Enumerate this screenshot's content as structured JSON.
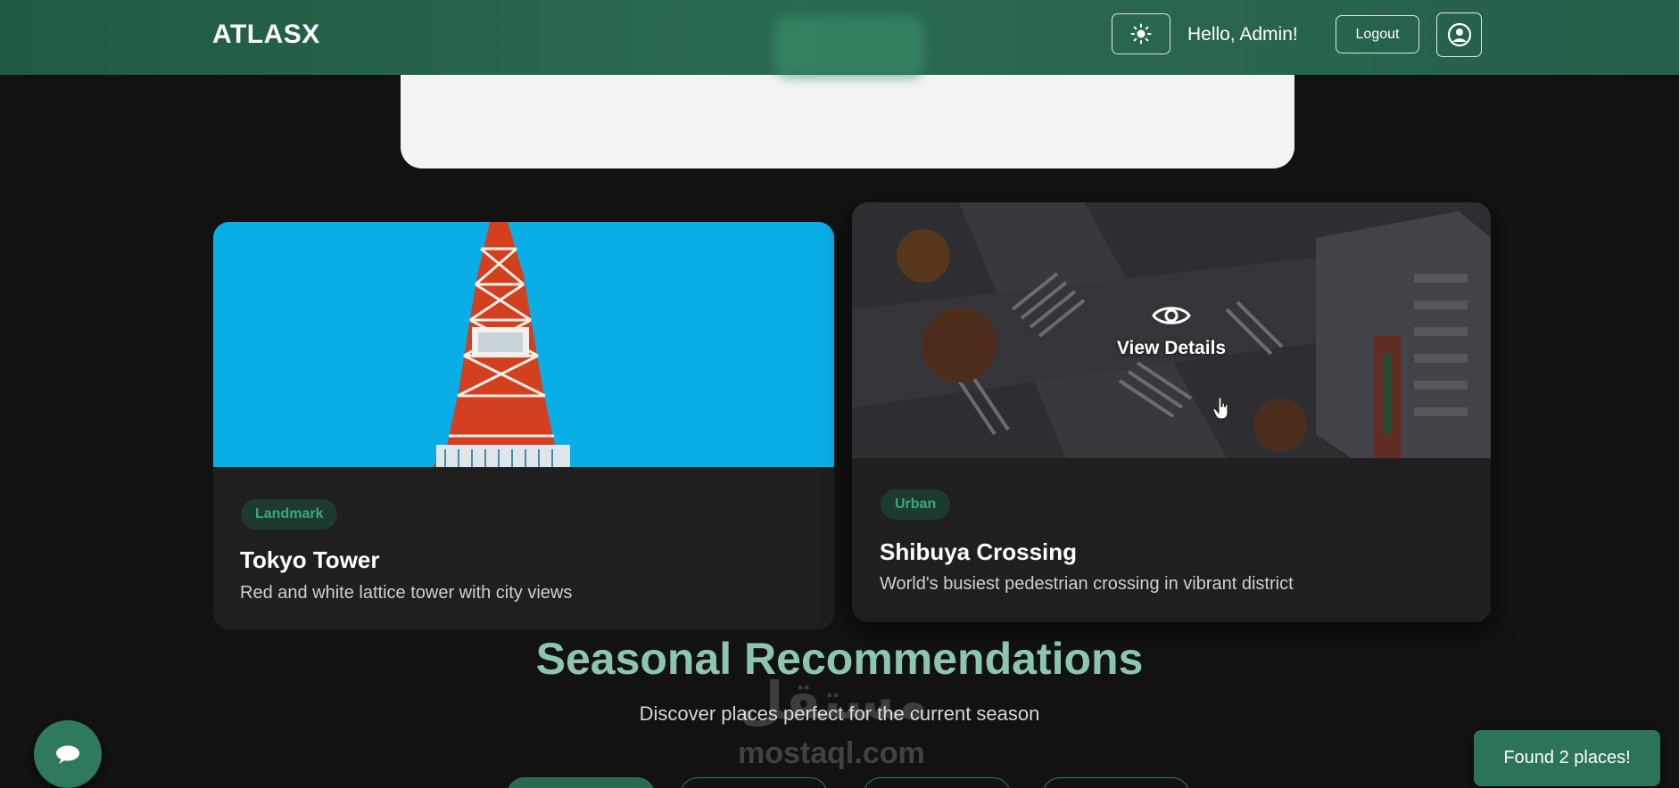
{
  "header": {
    "brand": "ATLASX",
    "theme_icon": "sun-icon",
    "greeting": "Hello, Admin!",
    "logout_label": "Logout",
    "profile_icon": "user-circle-icon"
  },
  "places": [
    {
      "tag": "Landmark",
      "title": "Tokyo Tower",
      "description": "Red and white lattice tower with city views",
      "image": "tokyo-tower-photo"
    },
    {
      "tag": "Urban",
      "title": "Shibuya Crossing",
      "description": "World's busiest pedestrian crossing in vibrant district",
      "image": "shibuya-crossing-photo",
      "overlay_label": "View Details",
      "overlay_icon": "eye-icon"
    }
  ],
  "seasonal": {
    "title": "Seasonal Recommendations",
    "subtitle": "Discover places perfect for the current season"
  },
  "watermark": {
    "arabic": "مستقل",
    "latin": "mostaql.com"
  },
  "chat": {
    "icon": "chat-bubble-icon"
  },
  "toast": {
    "message": "Found 2 places!"
  },
  "colors": {
    "header_bg": "#2a6a4f",
    "page_bg": "#121212",
    "card_bg": "#1f1f1f",
    "accent": "#3ea77a",
    "title_accent": "#8ec5ad"
  }
}
